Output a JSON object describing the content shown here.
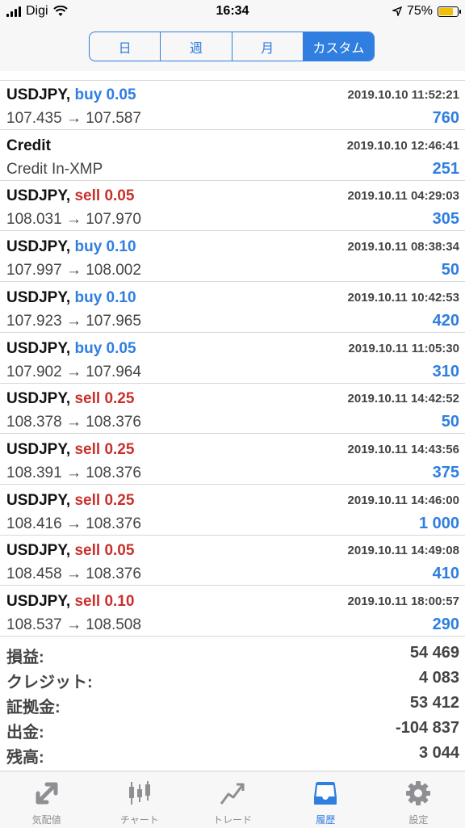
{
  "status": {
    "carrier": "Digi",
    "time": "16:34",
    "battery": "75%"
  },
  "segments": [
    "日",
    "週",
    "月",
    "カスタム"
  ],
  "active_segment": "カスタム",
  "rows": [
    {
      "symbol": "USDJPY,",
      "action": "buy 0.05",
      "side": "buy",
      "date": "2019.10.10 11:52:21",
      "prices": "107.435 → 107.587",
      "profit": "760"
    },
    {
      "symbol": "Credit",
      "action": "",
      "side": "",
      "date": "2019.10.10 12:46:41",
      "prices": "Credit In-XMP",
      "profit": "251"
    },
    {
      "symbol": "USDJPY,",
      "action": "sell 0.05",
      "side": "sell",
      "date": "2019.10.11 04:29:03",
      "prices": "108.031 → 107.970",
      "profit": "305"
    },
    {
      "symbol": "USDJPY,",
      "action": "buy 0.10",
      "side": "buy",
      "date": "2019.10.11 08:38:34",
      "prices": "107.997 → 108.002",
      "profit": "50"
    },
    {
      "symbol": "USDJPY,",
      "action": "buy 0.10",
      "side": "buy",
      "date": "2019.10.11 10:42:53",
      "prices": "107.923 → 107.965",
      "profit": "420"
    },
    {
      "symbol": "USDJPY,",
      "action": "buy 0.05",
      "side": "buy",
      "date": "2019.10.11 11:05:30",
      "prices": "107.902 → 107.964",
      "profit": "310"
    },
    {
      "symbol": "USDJPY,",
      "action": "sell 0.25",
      "side": "sell",
      "date": "2019.10.11 14:42:52",
      "prices": "108.378 → 108.376",
      "profit": "50"
    },
    {
      "symbol": "USDJPY,",
      "action": "sell 0.25",
      "side": "sell",
      "date": "2019.10.11 14:43:56",
      "prices": "108.391 → 108.376",
      "profit": "375"
    },
    {
      "symbol": "USDJPY,",
      "action": "sell 0.25",
      "side": "sell",
      "date": "2019.10.11 14:46:00",
      "prices": "108.416 → 108.376",
      "profit": "1 000"
    },
    {
      "symbol": "USDJPY,",
      "action": "sell 0.05",
      "side": "sell",
      "date": "2019.10.11 14:49:08",
      "prices": "108.458 → 108.376",
      "profit": "410"
    },
    {
      "symbol": "USDJPY,",
      "action": "sell 0.10",
      "side": "sell",
      "date": "2019.10.11 18:00:57",
      "prices": "108.537 → 108.508",
      "profit": "290"
    }
  ],
  "summary": [
    {
      "label": "損益:",
      "value": "54 469"
    },
    {
      "label": "クレジット:",
      "value": "4 083"
    },
    {
      "label": "証拠金:",
      "value": "53 412"
    },
    {
      "label": "出金:",
      "value": "-104 837"
    },
    {
      "label": "残高:",
      "value": "3 044"
    }
  ],
  "tabs": [
    {
      "label": "気配値",
      "icon": "quotes-arrow-icon"
    },
    {
      "label": "チャート",
      "icon": "candlestick-chart-icon"
    },
    {
      "label": "トレード",
      "icon": "trade-line-icon"
    },
    {
      "label": "履歴",
      "icon": "history-tray-icon"
    },
    {
      "label": "設定",
      "icon": "gear-icon"
    }
  ],
  "active_tab": "履歴",
  "colors": {
    "accent": "#2f7ee0",
    "sell": "#c9302c",
    "buy": "#2f7ee0",
    "inactive_tab": "#8e8e93"
  }
}
